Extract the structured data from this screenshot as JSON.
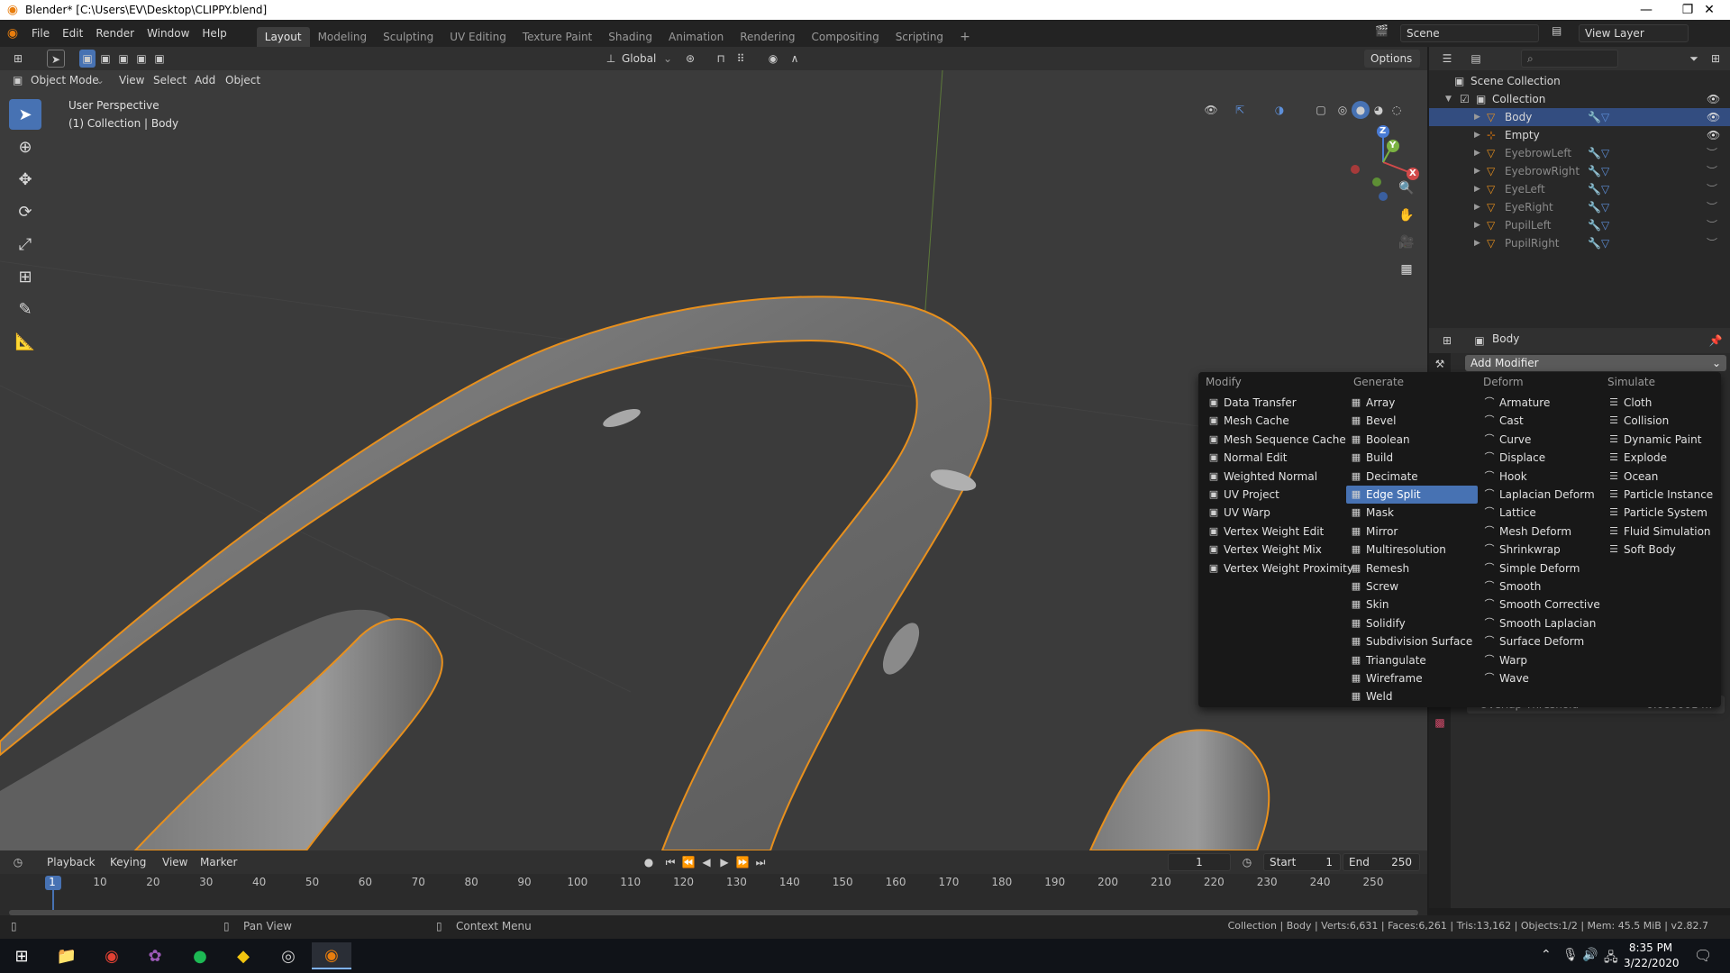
{
  "window": {
    "title": "Blender* [C:\\Users\\EV\\Desktop\\CLIPPY.blend]"
  },
  "menus": [
    "File",
    "Edit",
    "Render",
    "Window",
    "Help"
  ],
  "workspaces": [
    "Layout",
    "Modeling",
    "Sculpting",
    "UV Editing",
    "Texture Paint",
    "Shading",
    "Animation",
    "Rendering",
    "Compositing",
    "Scripting"
  ],
  "scene": {
    "label": "Scene",
    "view_layer": "View Layer"
  },
  "viewport_header": {
    "mode": "Object Mode",
    "menus": [
      "View",
      "Select",
      "Add",
      "Object"
    ],
    "orientation": "Global",
    "options": "Options"
  },
  "viewport": {
    "perspective": "User Perspective",
    "context": "(1) Collection | Body",
    "axis_x": "X",
    "axis_y": "Y",
    "axis_z": "Z"
  },
  "outliner": {
    "root": "Scene Collection",
    "collection": "Collection",
    "items": [
      "Body",
      "Empty",
      "EyebrowLeft",
      "EyebrowRight",
      "EyeLeft",
      "EyeRight",
      "PupilLeft",
      "PupilRight"
    ]
  },
  "properties": {
    "object": "Body",
    "add_modifier": "Add Modifier",
    "overlap_label": "Overlap Threshold",
    "overlap_value": "0.000001 m"
  },
  "modifier_menu": {
    "headers": [
      "Modify",
      "Generate",
      "Deform",
      "Simulate"
    ],
    "modify": [
      "Data Transfer",
      "Mesh Cache",
      "Mesh Sequence Cache",
      "Normal Edit",
      "Weighted Normal",
      "UV Project",
      "UV Warp",
      "Vertex Weight Edit",
      "Vertex Weight Mix",
      "Vertex Weight Proximity"
    ],
    "generate": [
      "Array",
      "Bevel",
      "Boolean",
      "Build",
      "Decimate",
      "Edge Split",
      "Mask",
      "Mirror",
      "Multiresolution",
      "Remesh",
      "Screw",
      "Skin",
      "Solidify",
      "Subdivision Surface",
      "Triangulate",
      "Wireframe",
      "Weld"
    ],
    "deform": [
      "Armature",
      "Cast",
      "Curve",
      "Displace",
      "Hook",
      "Laplacian Deform",
      "Lattice",
      "Mesh Deform",
      "Shrinkwrap",
      "Simple Deform",
      "Smooth",
      "Smooth Corrective",
      "Smooth Laplacian",
      "Surface Deform",
      "Warp",
      "Wave"
    ],
    "simulate": [
      "Cloth",
      "Collision",
      "Dynamic Paint",
      "Explode",
      "Ocean",
      "Particle Instance",
      "Particle System",
      "Fluid Simulation",
      "Soft Body"
    ],
    "highlighted": "Edge Split"
  },
  "timeline": {
    "menus": [
      "Playback",
      "Keying",
      "View",
      "Marker"
    ],
    "current_frame": "1",
    "start_label": "Start",
    "start": "1",
    "end_label": "End",
    "end": "250",
    "ticks": [
      "1",
      "10",
      "20",
      "30",
      "40",
      "50",
      "60",
      "70",
      "80",
      "90",
      "100",
      "110",
      "120",
      "130",
      "140",
      "150",
      "160",
      "170",
      "180",
      "190",
      "200",
      "210",
      "220",
      "230",
      "240",
      "250"
    ]
  },
  "statusbar": {
    "pan": "Pan View",
    "context_menu": "Context Menu",
    "stats": "Collection | Body | Verts:6,631 | Faces:6,261 | Tris:13,162 | Objects:1/2 | Mem: 45.5 MiB | v2.82.7"
  },
  "taskbar": {
    "time": "8:35 PM",
    "date": "3/22/2020"
  },
  "colors": {
    "accent": "#4772b3",
    "selection_outline": "#e8901d",
    "blender_orange": "#e87d0d"
  }
}
